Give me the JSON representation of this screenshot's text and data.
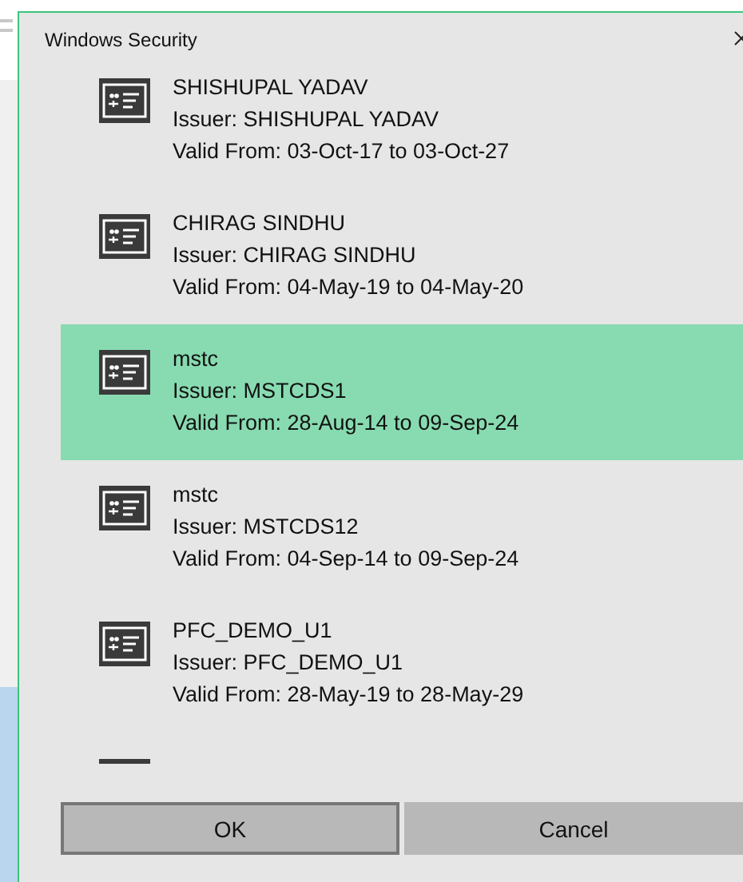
{
  "window": {
    "title": "Windows Security"
  },
  "certificates": {
    "items": [
      {
        "name": "SHISHUPAL YADAV",
        "issuer": "Issuer: SHISHUPAL YADAV",
        "validity": "Valid From: 03-Oct-17 to 03-Oct-27",
        "selected": false
      },
      {
        "name": "CHIRAG SINDHU",
        "issuer": "Issuer: CHIRAG SINDHU",
        "validity": "Valid From: 04-May-19 to 04-May-20",
        "selected": false
      },
      {
        "name": "mstc",
        "issuer": "Issuer: MSTCDS1",
        "validity": "Valid From: 28-Aug-14 to 09-Sep-24",
        "selected": true
      },
      {
        "name": "mstc",
        "issuer": "Issuer: MSTCDS12",
        "validity": "Valid From: 04-Sep-14 to 09-Sep-24",
        "selected": false
      },
      {
        "name": "PFC_DEMO_U1",
        "issuer": "Issuer: PFC_DEMO_U1",
        "validity": "Valid From: 28-May-19 to 28-May-29",
        "selected": false
      }
    ],
    "more_below": true
  },
  "buttons": [
    {
      "label": "OK",
      "kind": "default"
    },
    {
      "label": "Cancel",
      "kind": "normal"
    }
  ]
}
